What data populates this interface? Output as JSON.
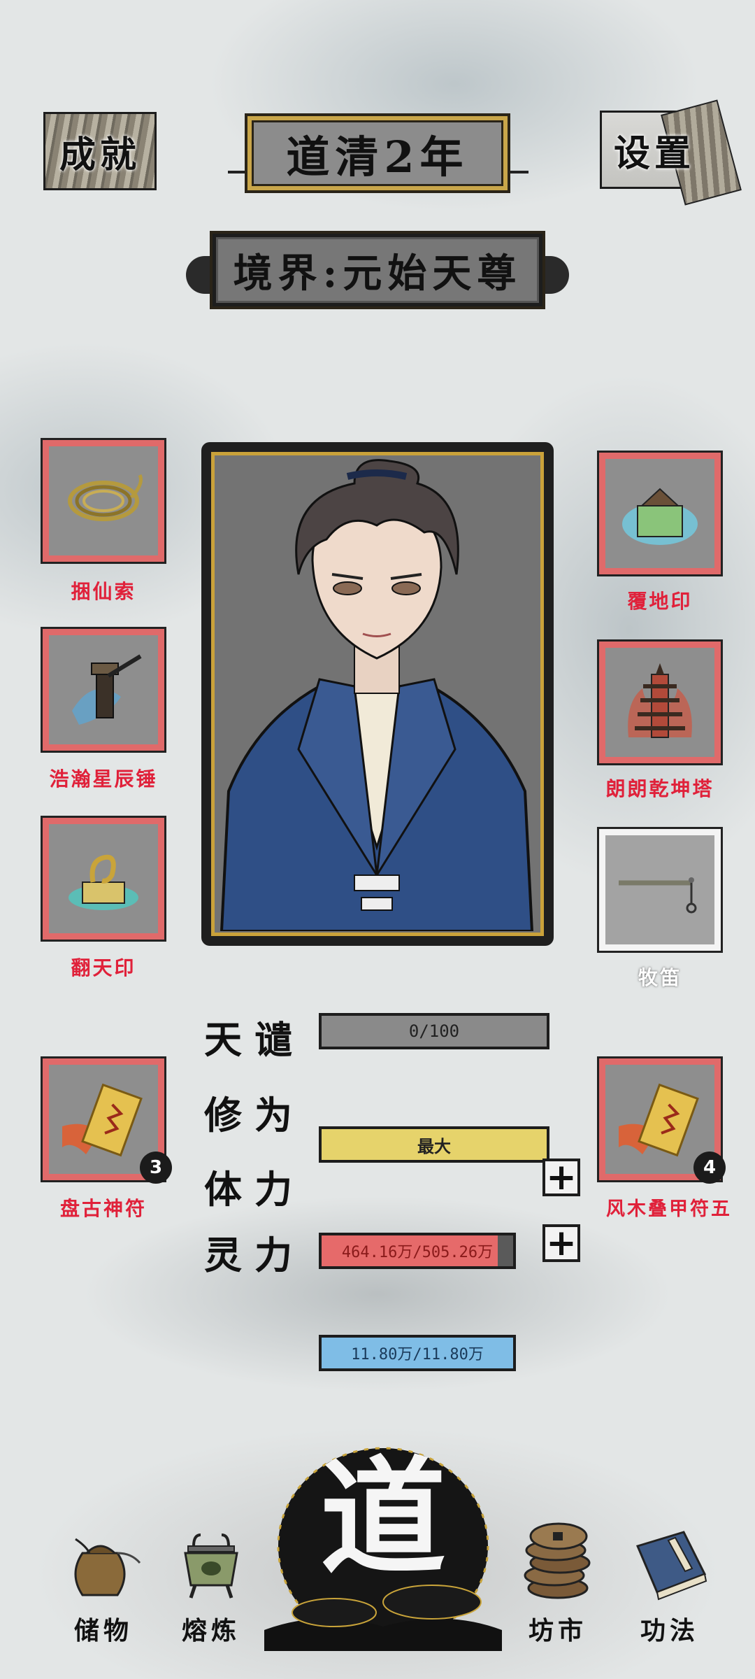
{
  "header": {
    "achievements_label": "成就",
    "settings_label": "设置",
    "year_title": "道清2年",
    "realm": "境界:元始天尊"
  },
  "equipment": {
    "left": [
      {
        "name": "捆仙索"
      },
      {
        "name": "浩瀚星辰锤"
      },
      {
        "name": "翻天印"
      },
      {
        "name": "盘古神符",
        "count": "3"
      }
    ],
    "right": [
      {
        "name": "覆地印"
      },
      {
        "name": "朗朗乾坤塔"
      },
      {
        "name": "牧笛"
      },
      {
        "name": "风木叠甲符五",
        "count": "4"
      }
    ]
  },
  "stats": {
    "tribulation": {
      "label": "天谴",
      "value": "0/100",
      "fraction": 0.0
    },
    "cultivation": {
      "label": "修为",
      "value": "最大",
      "fraction": 1.0
    },
    "stamina": {
      "label": "体力",
      "value": "464.16万/505.26万",
      "fraction": 0.92
    },
    "spirit": {
      "label": "灵力",
      "value": "11.80万/11.80万",
      "fraction": 1.0
    }
  },
  "colors": {
    "slot_border": "#e06a6a",
    "label_red": "#e0213a",
    "cultivation_bar": "#e6d36b",
    "stamina_bar": "#e66a6a",
    "spirit_bar": "#7fbde6",
    "tribulation_bar": "#8a8a8a",
    "gold_frame": "#caa23a"
  },
  "nav": {
    "storage": "储物",
    "smelt": "熔炼",
    "dao": "道",
    "market": "坊市",
    "skills": "功法"
  }
}
